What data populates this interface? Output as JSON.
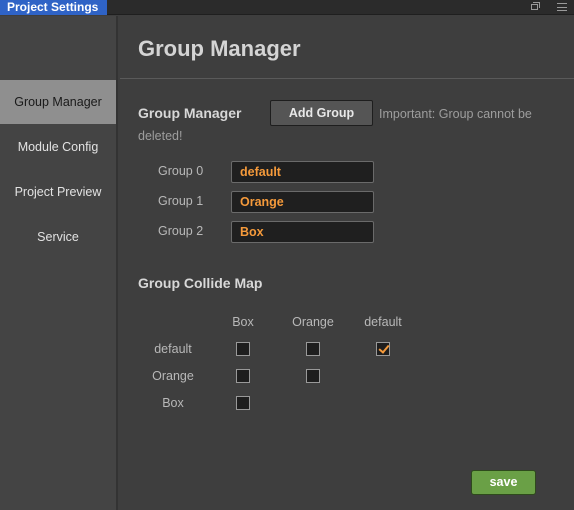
{
  "window": {
    "tab_title": "Project Settings",
    "icons": [
      "restore-icon",
      "menu-icon"
    ]
  },
  "sidebar": {
    "items": [
      {
        "label": "Group Manager",
        "active": true
      },
      {
        "label": "Module Config",
        "active": false
      },
      {
        "label": "Project Preview",
        "active": false
      },
      {
        "label": "Service",
        "active": false
      }
    ]
  },
  "main": {
    "page_title": "Group Manager",
    "group_manager": {
      "section_title": "Group Manager",
      "add_button": "Add Group",
      "note_line1": "Important: Group cannot be",
      "note_line2": "deleted!",
      "groups": [
        {
          "label": "Group 0",
          "value": "default"
        },
        {
          "label": "Group 1",
          "value": "Orange"
        },
        {
          "label": "Group 2",
          "value": "Box"
        }
      ]
    },
    "collide_map": {
      "section_title": "Group Collide Map",
      "columns": [
        "Box",
        "Orange",
        "default"
      ],
      "rows": [
        "default",
        "Orange",
        "Box"
      ],
      "matrix": [
        [
          false,
          false,
          true
        ],
        [
          false,
          false
        ],
        [
          false
        ]
      ]
    },
    "save_button": "save"
  },
  "colors": {
    "accent_orange": "#f59a3b",
    "tab_blue": "#2f63c6",
    "save_green": "#6aa046",
    "active_nav": "#8f8f8f"
  }
}
